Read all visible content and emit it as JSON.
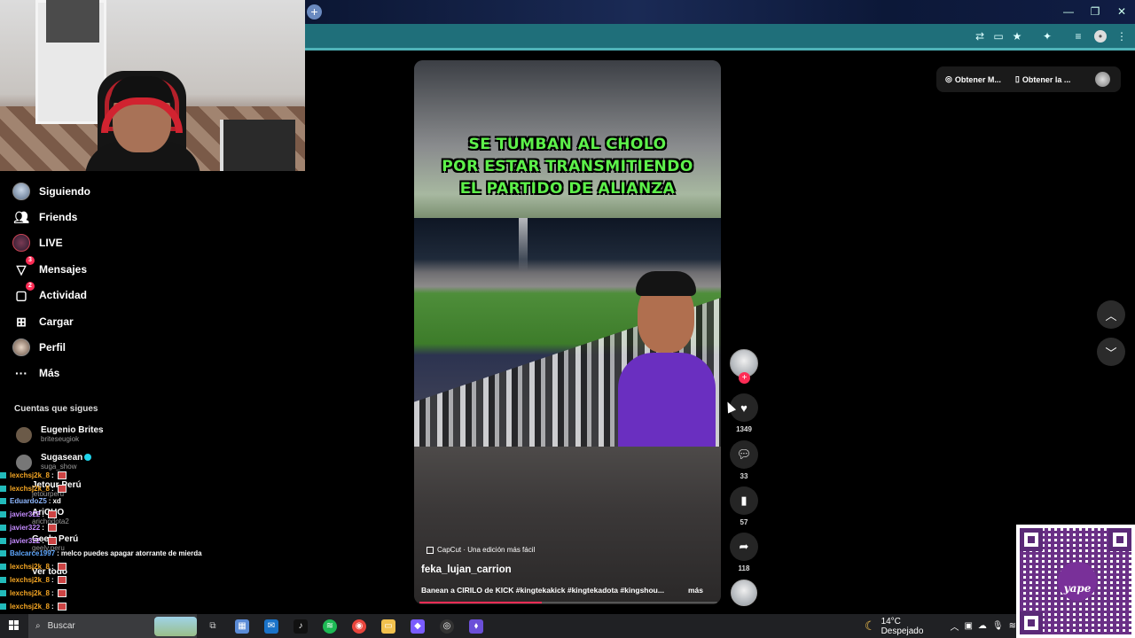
{
  "browser": {
    "window_controls": [
      "—",
      "❐",
      "✕"
    ]
  },
  "top_pills": {
    "pill1": "Obtener M...",
    "pill2": "Obtener la ..."
  },
  "sidebar": {
    "nav": [
      {
        "label": "Siguiendo",
        "icon": "avatar-icon"
      },
      {
        "label": "Friends",
        "icon": "friends-icon"
      },
      {
        "label": "LIVE",
        "icon": "live-icon"
      },
      {
        "label": "Mensajes",
        "icon": "messages-icon",
        "badge": "3"
      },
      {
        "label": "Actividad",
        "icon": "activity-icon",
        "badge": "2"
      },
      {
        "label": "Cargar",
        "icon": "upload-icon"
      },
      {
        "label": "Perfil",
        "icon": "profile-icon"
      },
      {
        "label": "Más",
        "icon": "more-icon"
      }
    ],
    "section_title": "Cuentas que sigues",
    "following": [
      {
        "name": "Eugenio Brites",
        "user": "briteseugiok"
      },
      {
        "name": "Sugasean",
        "user": "suga_show",
        "verified": true
      },
      {
        "name": "Jetour Perú",
        "user": "jetourperu"
      },
      {
        "name": "AriCHO",
        "user": "arichodota2"
      },
      {
        "name": "Geely Perú",
        "user": "geely.peru"
      },
      {
        "name": "Ver todo",
        "user": ""
      }
    ]
  },
  "chat": [
    {
      "user": "lexchsj2k_8",
      "msg": "",
      "color": "#f5a623"
    },
    {
      "user": "lexchsj2k_8",
      "msg": "",
      "color": "#f5a623"
    },
    {
      "user": "EduardoZ5",
      "msg": "xd",
      "color": "#8fb8ff"
    },
    {
      "user": "javier322",
      "msg": "",
      "color": "#c58cff"
    },
    {
      "user": "javier322",
      "msg": "",
      "color": "#c58cff"
    },
    {
      "user": "javier322",
      "msg": "",
      "color": "#c58cff"
    },
    {
      "user": "Balcarce1997",
      "msg": "melco puedes apagar atorrante de mierda",
      "color": "#5fa8ff"
    },
    {
      "user": "lexchsj2k_8",
      "msg": "",
      "color": "#f5a623"
    },
    {
      "user": "lexchsj2k_8",
      "msg": "",
      "color": "#f5a623"
    },
    {
      "user": "lexchsj2k_8",
      "msg": "",
      "color": "#f5a623"
    },
    {
      "user": "lexchsj2k_8",
      "msg": "",
      "color": "#f5a623"
    }
  ],
  "video": {
    "caption_lines": [
      "SE TUMBAN AL CHOLO",
      "POR ESTAR TRANSMITIENDO",
      "EL PARTIDO DE ALIANZA"
    ],
    "capcut": "CapCut · Una edición más fácil",
    "username": "feka_lujan_carrion",
    "description": "Banean a CIRILO de KICK #kingtekakick #kingtekadota #kingshou...",
    "more": "más",
    "progress": 0.41
  },
  "actions": {
    "likes": "1349",
    "comments": "33",
    "saves": "57",
    "shares": "118"
  },
  "taskbar": {
    "search_placeholder": "Buscar",
    "weather": "14°C  Despejado"
  },
  "colors": {
    "accent": "#fe2c55",
    "caption_green": "#5df04a",
    "urlbar": "#1f6f7a"
  }
}
